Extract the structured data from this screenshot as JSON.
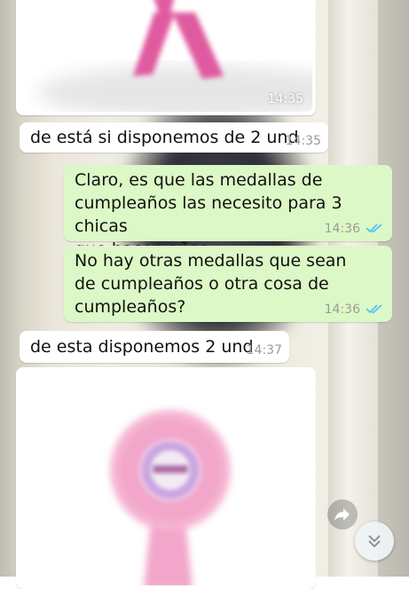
{
  "messages": [
    {
      "type": "image",
      "direction": "incoming",
      "time": "14:35"
    },
    {
      "type": "text",
      "direction": "incoming",
      "text": "de está si disponemos de 2 und",
      "time": "14:35"
    },
    {
      "type": "text",
      "direction": "outgoing",
      "lines": [
        "Claro, es que las medallas de",
        "cumpleaños las necesito para 3 chicas",
        "que hacen años"
      ],
      "time": "14:36",
      "status": "read"
    },
    {
      "type": "text",
      "direction": "outgoing",
      "lines": [
        "No hay otras medallas que sean",
        "de cumpleaños o otra cosa de",
        "cumpleaños?"
      ],
      "time": "14:36",
      "status": "read"
    },
    {
      "type": "text",
      "direction": "incoming",
      "text": "de esta disponemos 2 und",
      "time": "14:37"
    },
    {
      "type": "image",
      "direction": "incoming"
    }
  ],
  "icons": {
    "forward": "forward-icon",
    "scroll_down": "chevron-double-down-icon",
    "read_receipt": "double-check-icon"
  },
  "colors": {
    "incoming_bubble": "#ffffff",
    "outgoing_bubble": "#dcf8c6",
    "read_ticks": "#4fc3f7",
    "ribbon_pink": "#e05aa0",
    "rosette_pink": "#f2a6c9"
  }
}
